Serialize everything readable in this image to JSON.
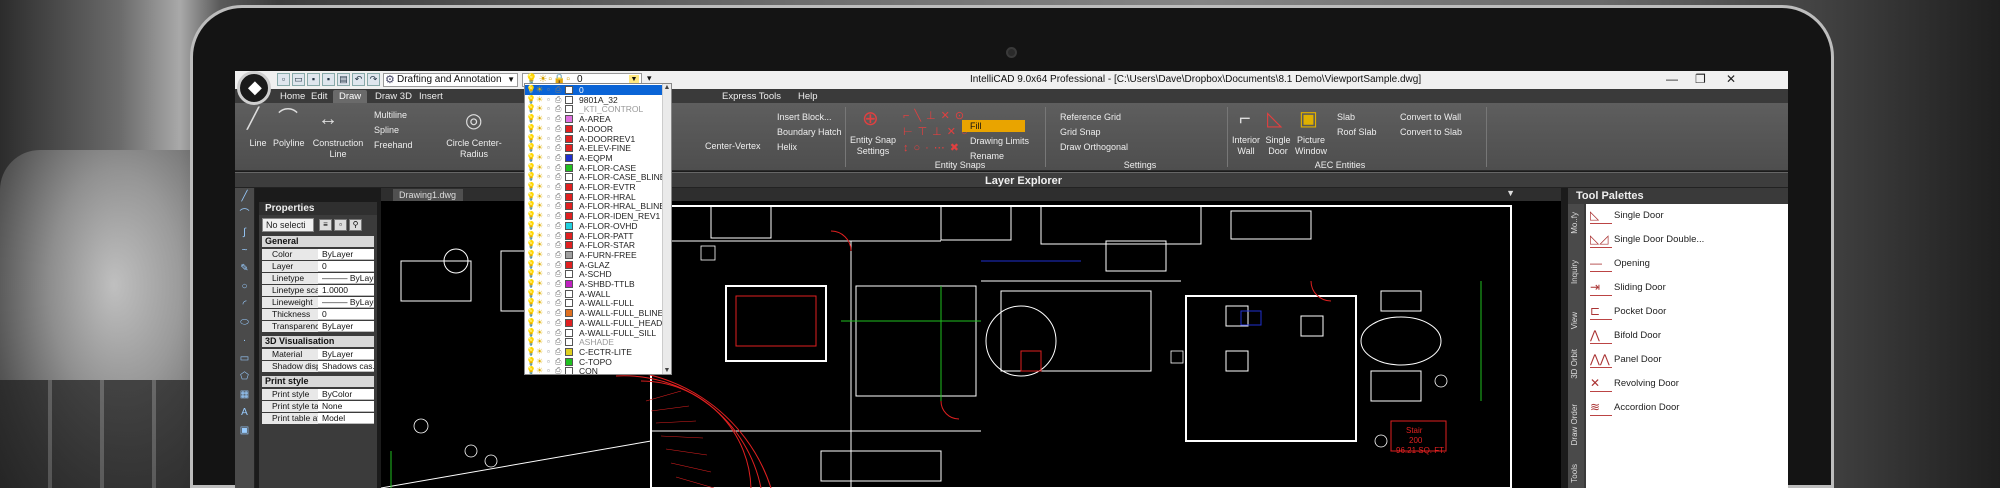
{
  "app": {
    "workspace": "Drafting and Annotation",
    "current_layer": "0",
    "title": "IntelliCAD 9.0x64 Professional - [C:\\Users\\Dave\\Dropbox\\Documents\\8.1 Demo\\ViewportSample.dwg]",
    "window_controls": [
      "—",
      "❐",
      "✕"
    ]
  },
  "tabs": [
    "Home",
    "Edit",
    "Draw",
    "Draw 3D",
    "Insert",
    "Express Tools",
    "Help"
  ],
  "active_tab": "Draw",
  "ribbon": {
    "draw": {
      "line": "Line",
      "polyline": "Polyline",
      "construction_line": "Construction Line",
      "multiline": "Multiline",
      "spline": "Spline",
      "freehand": "Freehand",
      "circle": "Circle Center-Radius",
      "center_vertex": "Center-Vertex",
      "insert_block": "Insert Block...",
      "boundary_hatch": "Boundary Hatch",
      "helix": "Helix"
    },
    "entity_snaps": {
      "settings": "Entity Snap Settings",
      "group": "Entity Snaps"
    },
    "settings": {
      "reference_grid": "Reference Grid",
      "grid_snap": "Grid Snap",
      "draw_orthogonal": "Draw Orthogonal",
      "fill": "Fill",
      "drawing_limits": "Drawing Limits",
      "rename": "Rename",
      "group": "Settings"
    },
    "aec": {
      "interior_wall": "Interior Wall",
      "single_door": "Single Door",
      "picture_window": "Picture Window",
      "slab": "Slab",
      "roof_slab": "Roof Slab",
      "convert_to_wall": "Convert to Wall",
      "convert_to_slab": "Convert to Slab",
      "group": "AEC Entities"
    }
  },
  "layer_explorer": "Layer Explorer",
  "properties": {
    "title": "Properties",
    "selection": "No selecti",
    "sections": [
      {
        "name": "General",
        "rows": [
          {
            "k": "Color",
            "v": "ByLayer"
          },
          {
            "k": "Layer",
            "v": "0"
          },
          {
            "k": "Linetype",
            "v": "——— ByLayer"
          },
          {
            "k": "Linetype scale",
            "v": "1.0000"
          },
          {
            "k": "Lineweight",
            "v": "——— ByLayer"
          },
          {
            "k": "Thickness",
            "v": "0"
          },
          {
            "k": "Transparency",
            "v": "ByLayer"
          }
        ]
      },
      {
        "name": "3D Visualisation",
        "rows": [
          {
            "k": "Material",
            "v": "ByLayer"
          },
          {
            "k": "Shadow displ",
            "v": "Shadows cas..."
          }
        ]
      },
      {
        "name": "Print style",
        "rows": [
          {
            "k": "Print style",
            "v": "ByColor"
          },
          {
            "k": "Print style table",
            "v": "None"
          },
          {
            "k": "Print table att...",
            "v": "Model"
          }
        ]
      }
    ]
  },
  "document_tab": "Drawing1.dwg",
  "tool_palettes": {
    "title": "Tool Palettes",
    "side_tabs": [
      "Mo..fy",
      "Inquiry",
      "View",
      "3D Orbit",
      "Draw Order",
      "Tools"
    ],
    "items": [
      "Single Door",
      "Single Door Double...",
      "Opening",
      "Sliding Door",
      "Pocket Door",
      "Bifold Door",
      "Panel Door",
      "Revolving Door",
      "Accordion Door"
    ]
  },
  "layers": [
    {
      "name": "0",
      "color": "#ffffff"
    },
    {
      "name": "9801A_32",
      "color": "#ffffff"
    },
    {
      "name": "_KTI_CONTROL",
      "color": "#ffffff",
      "dim": true
    },
    {
      "name": "A-AREA",
      "color": "#e070e0"
    },
    {
      "name": "A-DOOR",
      "color": "#e02020"
    },
    {
      "name": "A-DOORREV1",
      "color": "#e02020"
    },
    {
      "name": "A-ELEV-FINE",
      "color": "#e02020"
    },
    {
      "name": "A-EQPM",
      "color": "#2030d0"
    },
    {
      "name": "A-FLOR-CASE",
      "color": "#20c020"
    },
    {
      "name": "A-FLOR-CASE_BLINE",
      "color": "#ffffff"
    },
    {
      "name": "A-FLOR-EVTR",
      "color": "#e02020"
    },
    {
      "name": "A-FLOR-HRAL",
      "color": "#e02020"
    },
    {
      "name": "A-FLOR-HRAL_BLINE",
      "color": "#e02020"
    },
    {
      "name": "A-FLOR-IDEN_REV1",
      "color": "#e02020"
    },
    {
      "name": "A-FLOR-OVHD",
      "color": "#20d0e0"
    },
    {
      "name": "A-FLOR-PATT",
      "color": "#e02020"
    },
    {
      "name": "A-FLOR-STAR",
      "color": "#e02020"
    },
    {
      "name": "A-FURN-FREE",
      "color": "#a0a0a0"
    },
    {
      "name": "A-GLAZ",
      "color": "#e02020"
    },
    {
      "name": "A-SCHD",
      "color": "#ffffff"
    },
    {
      "name": "A-SHBD-TTLB",
      "color": "#c020c0"
    },
    {
      "name": "A-WALL",
      "color": "#ffffff"
    },
    {
      "name": "A-WALL-FULL",
      "color": "#ffffff"
    },
    {
      "name": "A-WALL-FULL_BLINE",
      "color": "#e07020"
    },
    {
      "name": "A-WALL-FULL_HEAD",
      "color": "#e02020"
    },
    {
      "name": "A-WALL-FULL_SILL",
      "color": "#ffffff"
    },
    {
      "name": "ASHADE",
      "color": "#ffffff",
      "dim": true
    },
    {
      "name": "C-ECTR-LITE",
      "color": "#e0d020"
    },
    {
      "name": "C-TOPO",
      "color": "#20c020"
    },
    {
      "name": "CON",
      "color": "#ffffff"
    }
  ],
  "drawing": {
    "stair_label": "Stair",
    "stair_number": "200",
    "area_text": "96.21 SQ. FT."
  }
}
